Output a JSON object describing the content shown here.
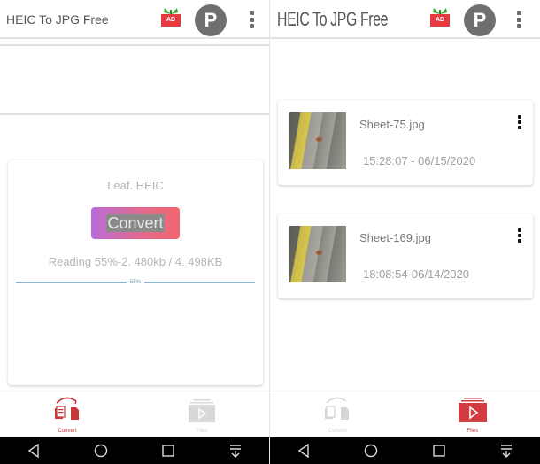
{
  "left_screen": {
    "app_title": "HEIC To JPG Free",
    "ad_badge": "AD",
    "avatar_letter": "P",
    "convert_card": {
      "file_name": "Leaf. HEIC",
      "convert_button": "Convert",
      "progress_text": "Reading 55%-2. 480kb / 4. 498KB",
      "progress_percent": 55,
      "progress_label": "55%"
    },
    "bottom_nav": [
      {
        "label": "Convert",
        "icon": "convert-icon",
        "active": true
      },
      {
        "label": "Files",
        "icon": "files-icon",
        "active": false
      }
    ]
  },
  "right_screen": {
    "app_title": "HEIC To JPG Free",
    "ad_badge": "AD",
    "avatar_letter": "P",
    "files": [
      {
        "name": "Sheet-75.jpg",
        "timestamp": "15:28:07 - 06/15/2020"
      },
      {
        "name": "Sheet-169.jpg",
        "timestamp": "18:08:54-06/14/2020"
      }
    ],
    "bottom_nav": [
      {
        "label": "Convert",
        "icon": "convert-icon",
        "active": false
      },
      {
        "label": "Files",
        "icon": "files-icon",
        "active": true
      }
    ]
  },
  "system_nav": [
    "back",
    "home",
    "recents",
    "notifications-pull"
  ],
  "colors": {
    "accent_red": "#c9373d",
    "progress_blue": "#90b4cc",
    "button_gradient_start": "#b86cd9",
    "button_gradient_end": "#f06670"
  }
}
